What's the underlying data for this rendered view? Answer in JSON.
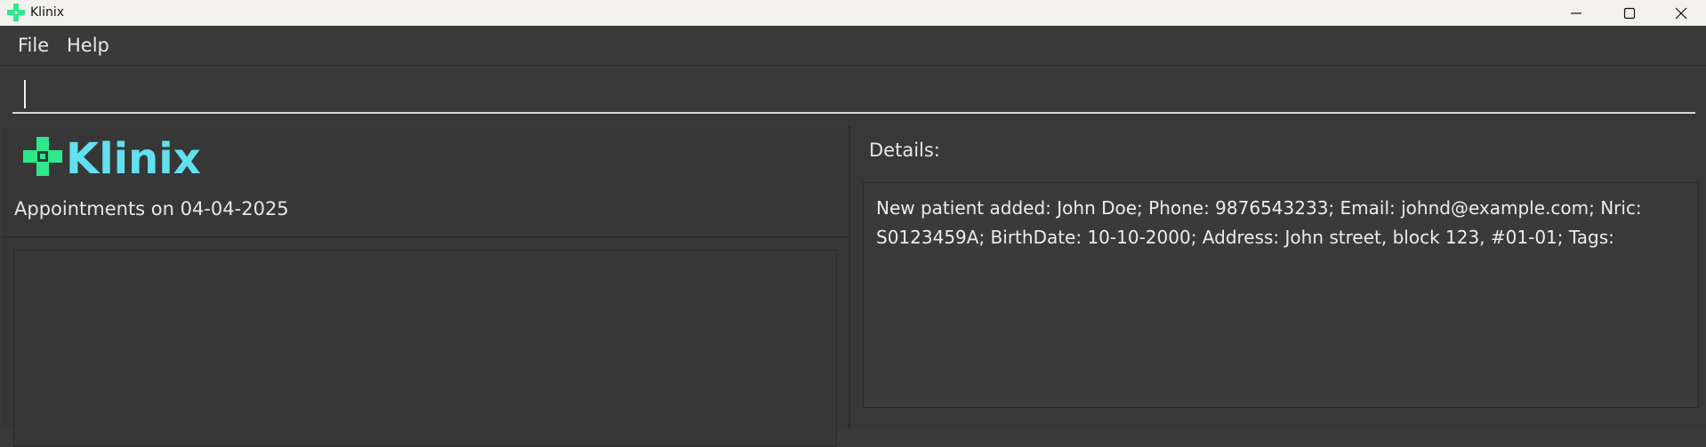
{
  "window": {
    "title": "Klinix",
    "brand_green": "#2ee88c",
    "brand_cyan": "#63e0ee",
    "controls": [
      "minimize-icon",
      "maximize-icon",
      "close-icon"
    ]
  },
  "menu": {
    "file_label": "File",
    "help_label": "Help"
  },
  "command": {
    "value": "",
    "placeholder": ""
  },
  "left": {
    "logo_text": "Klinix",
    "appointments_header": "Appointments on 04-04-2025",
    "appointments": []
  },
  "right": {
    "details_label": "Details:",
    "result_text": "New patient added: John Doe; Phone: 9876543233; Email: johnd@example.com; Nric: S0123459A; BirthDate: 10-10-2000; Address: John street, block 123, #01-01; Tags:"
  }
}
